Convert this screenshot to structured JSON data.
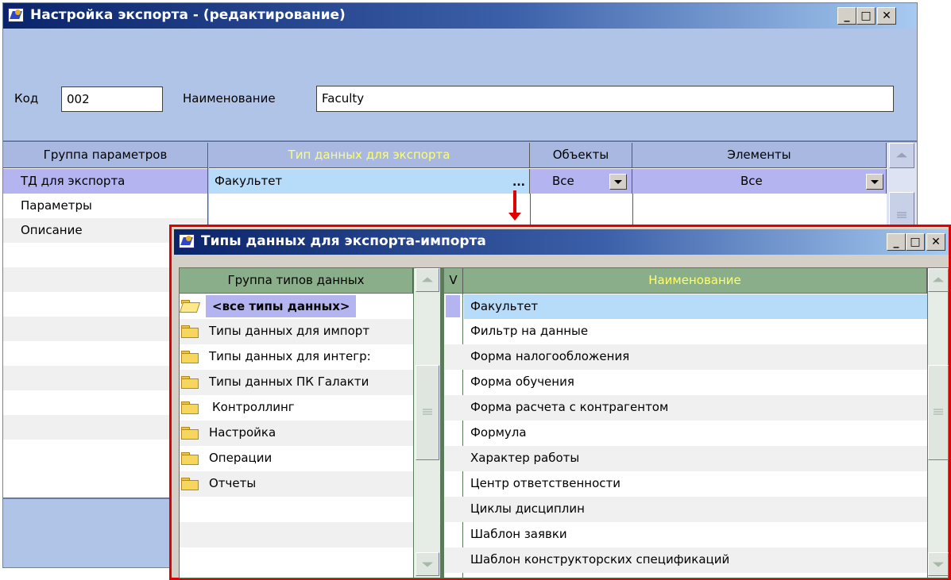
{
  "main_window": {
    "title": "Настройка экспорта - (редактирование)",
    "code_label": "Код",
    "code_value": "002",
    "name_label": "Наименование",
    "name_value": "Faculty",
    "left_header": "Группа параметров",
    "left_items": [
      "ТД для экспорта",
      "Параметры",
      "Описание"
    ],
    "columns": {
      "type": "Тип данных для экспорта",
      "objects": "Объекты",
      "elements": "Элементы"
    },
    "row": {
      "type": "Факультет",
      "ellipsis": "...",
      "objects": "Все",
      "elements": "Все"
    }
  },
  "popup": {
    "title": "Типы данных для экспорта-импорта",
    "left_header": "Группа типов данных",
    "v_header": "V",
    "right_header": "Наименование",
    "groups": [
      "<все типы данных>",
      "Типы данных для импорт",
      "Типы данных для интегр:",
      "Типы данных ПК Галакти",
      "Контроллинг",
      "Настройка",
      "Операции",
      "Отчеты"
    ],
    "items": [
      "Факультет",
      "Фильтр на данные",
      "Форма налогообложения",
      "Форма обучения",
      "Форма расчета с контрагентом",
      "Формула",
      "Характер работы",
      "Центр ответственности",
      "Циклы дисциплин",
      "Шаблон заявки",
      "Шаблон конструкторских спецификаций"
    ]
  },
  "colors": {
    "main_bg": "#b0c4e8",
    "header_bg": "#a8b8e0",
    "header_highlight_text": "#ffff66",
    "popup_header_bg": "#8aae8a",
    "selection": "#b7dcf9",
    "left_selection": "#b4b4f0",
    "arrow_red": "#e00000"
  }
}
